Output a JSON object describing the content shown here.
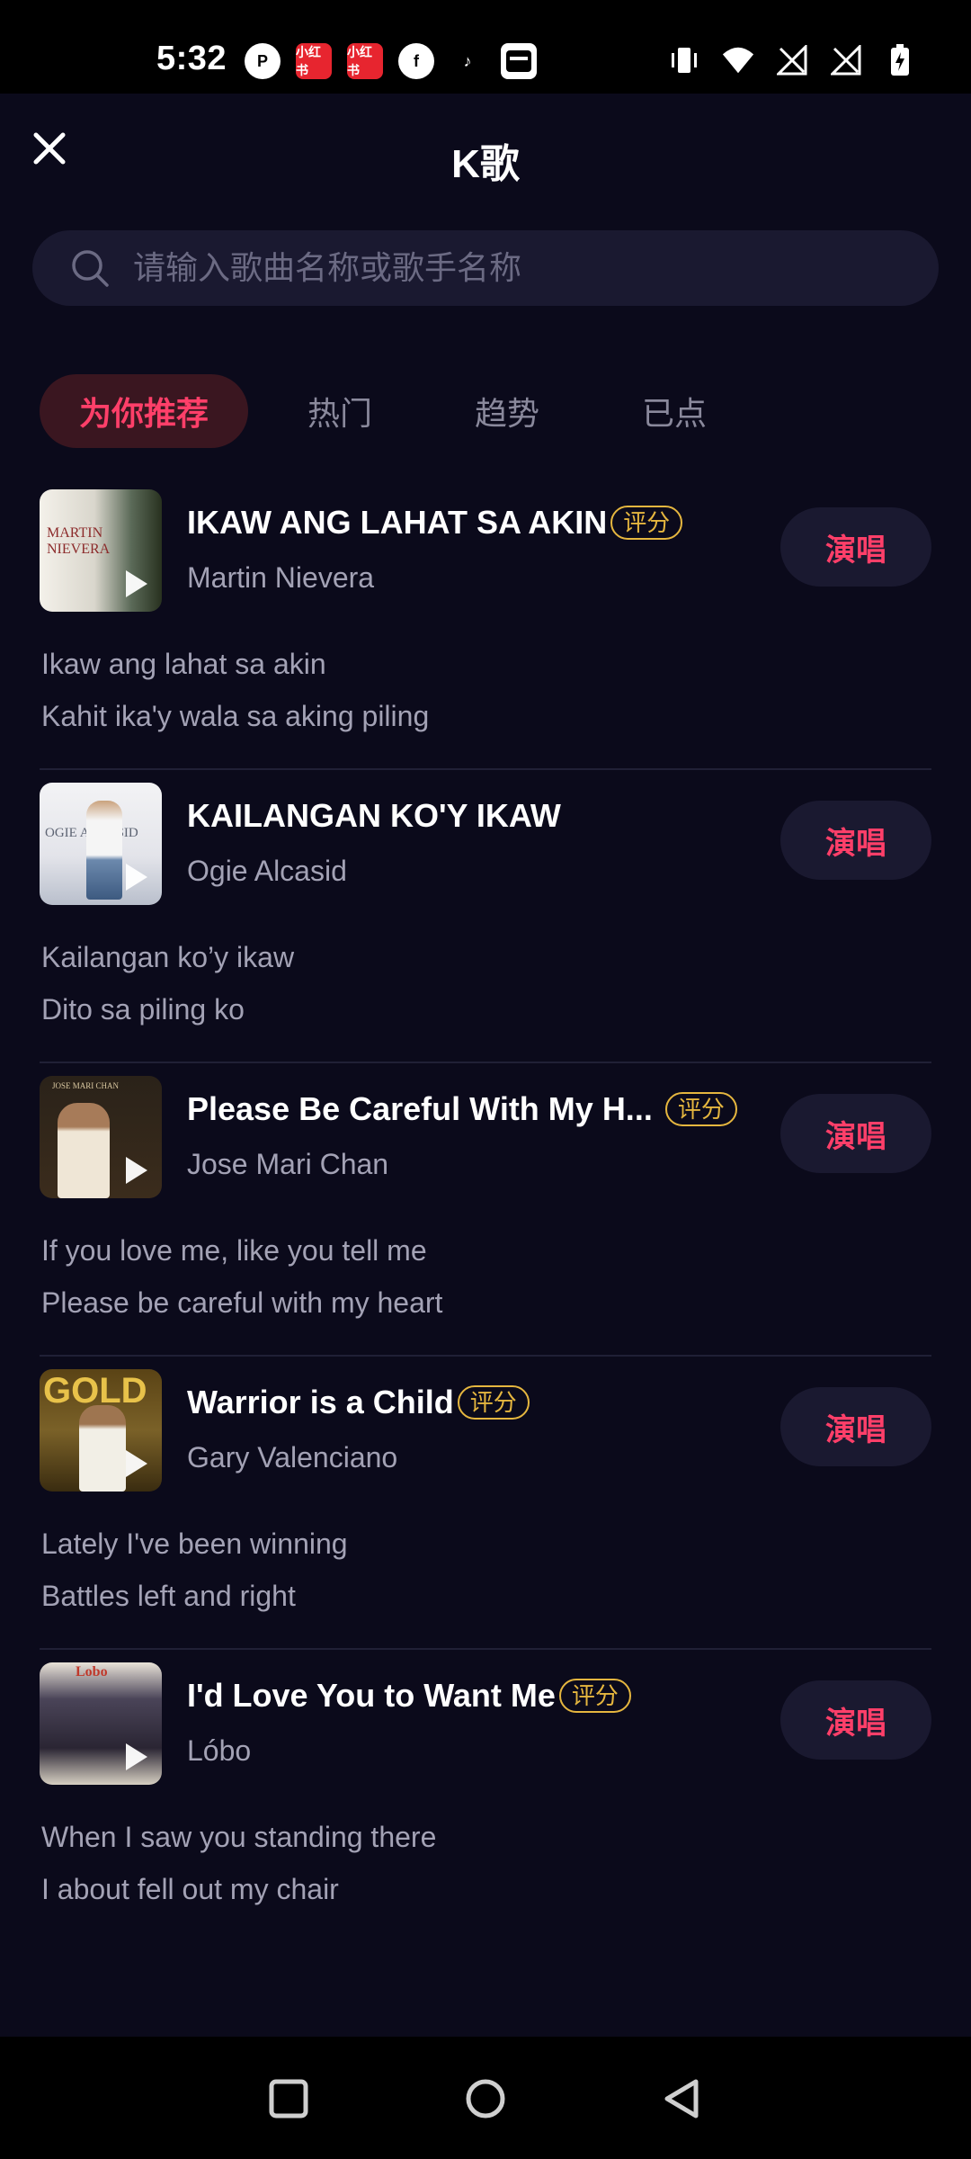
{
  "status_bar": {
    "time": "5:32",
    "left_icons": [
      "p-circle-icon",
      "xiaohongshu-icon",
      "xiaohongshu-icon",
      "facebook-icon",
      "tiktok-icon",
      "inbox-icon"
    ],
    "right_icons": [
      "vibrate-icon",
      "wifi-icon",
      "signal-icon",
      "signal-icon",
      "battery-charging-icon"
    ],
    "xhs_label": "小红书"
  },
  "header": {
    "title": "K歌",
    "close_icon": "close-icon"
  },
  "search": {
    "placeholder": "请输入歌曲名称或歌手名称"
  },
  "tabs": [
    {
      "label": "为你推荐",
      "active": true
    },
    {
      "label": "热门",
      "active": false
    },
    {
      "label": "趋势",
      "active": false
    },
    {
      "label": "已点",
      "active": false
    }
  ],
  "songs": [
    {
      "title": "IKAW ANG LAHAT SA AKIN",
      "badge": "评分",
      "artist": "Martin Nievera",
      "action": "演唱",
      "lyrics": [
        "Ikaw ang lahat sa akin",
        "Kahit ika'y wala sa aking piling"
      ],
      "cover_text": "MARTIN NIEVERA"
    },
    {
      "title": "KAILANGAN KO'Y IKAW",
      "badge": "",
      "artist": "Ogie Alcasid",
      "action": "演唱",
      "lyrics": [
        "Kailangan ko’y ikaw",
        "Dito sa piling ko"
      ],
      "cover_text": "OGIE ALCASID"
    },
    {
      "title": "Please Be Careful With My H...",
      "badge": "评分",
      "artist": "Jose Mari Chan",
      "action": "演唱",
      "lyrics": [
        "If you love me, like you tell me",
        "Please be careful with my heart"
      ],
      "cover_text": "JOSE MARI CHAN"
    },
    {
      "title": "Warrior is a Child",
      "badge": "评分",
      "artist": "Gary Valenciano",
      "action": "演唱",
      "lyrics": [
        "Lately I've been winning",
        "Battles left and right"
      ],
      "cover_text": "GOLD"
    },
    {
      "title": "I'd Love You to Want Me",
      "badge": "评分",
      "artist": "Lóbo",
      "action": "演唱",
      "lyrics": [
        "When I saw you standing there",
        "I about fell out my chair"
      ],
      "cover_text": "Lobo"
    }
  ],
  "nav_bar": {
    "icons": [
      "recents-square-icon",
      "home-circle-icon",
      "back-triangle-icon"
    ]
  }
}
